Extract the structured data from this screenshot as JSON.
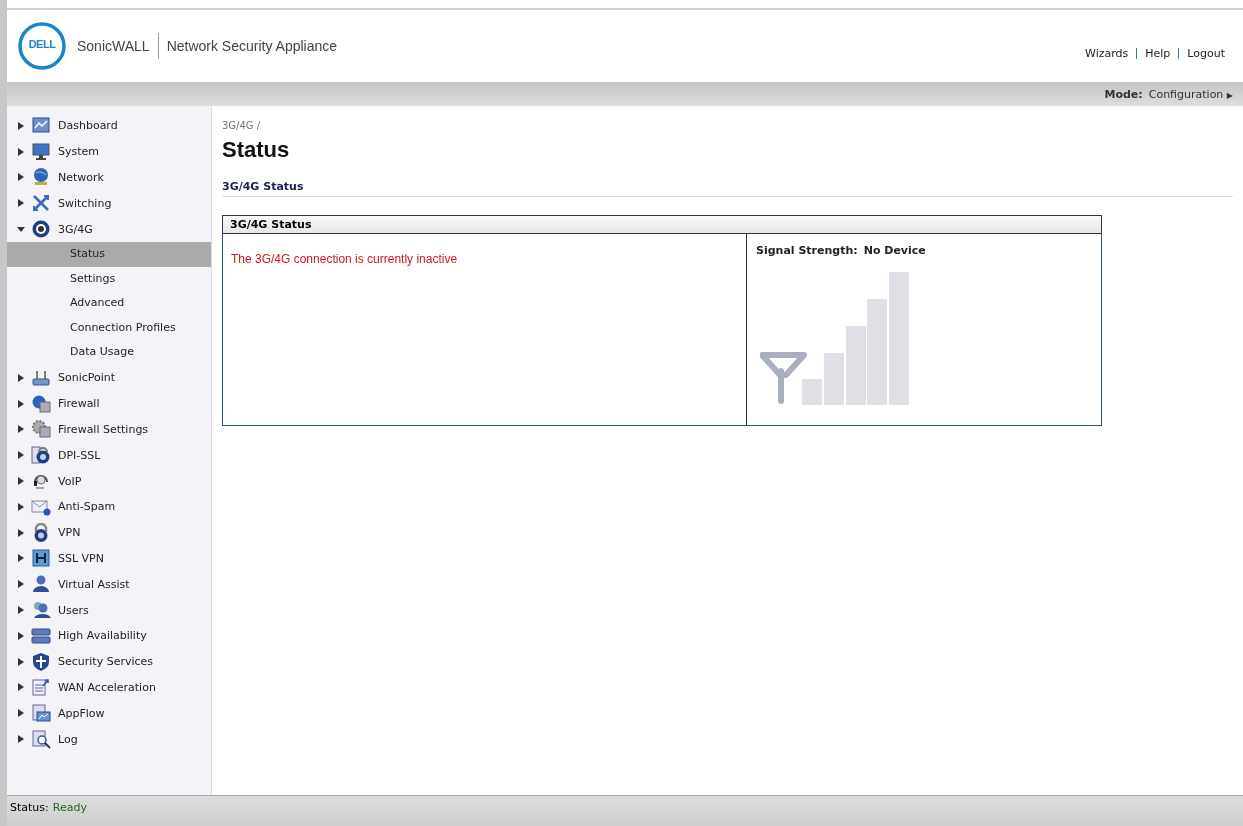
{
  "header": {
    "brand": "DELL",
    "product": "SonicWALL",
    "title": "Network Security Appliance",
    "links": [
      "Wizards",
      "Help",
      "Logout"
    ]
  },
  "toolbar": {
    "mode_label": "Mode:",
    "mode_value": "Configuration",
    "mode_arrow": "▶"
  },
  "sidebar": {
    "items": [
      {
        "label": "Dashboard",
        "expanded": false
      },
      {
        "label": "System",
        "expanded": false
      },
      {
        "label": "Network",
        "expanded": false
      },
      {
        "label": "Switching",
        "expanded": false
      },
      {
        "label": "3G/4G",
        "expanded": true,
        "children": [
          {
            "label": "Status",
            "selected": true
          },
          {
            "label": "Settings",
            "selected": false
          },
          {
            "label": "Advanced",
            "selected": false
          },
          {
            "label": "Connection Profiles",
            "selected": false
          },
          {
            "label": "Data Usage",
            "selected": false
          }
        ]
      },
      {
        "label": "SonicPoint",
        "expanded": false
      },
      {
        "label": "Firewall",
        "expanded": false
      },
      {
        "label": "Firewall Settings",
        "expanded": false
      },
      {
        "label": "DPI-SSL",
        "expanded": false
      },
      {
        "label": "VoIP",
        "expanded": false
      },
      {
        "label": "Anti-Spam",
        "expanded": false
      },
      {
        "label": "VPN",
        "expanded": false
      },
      {
        "label": "SSL VPN",
        "expanded": false
      },
      {
        "label": "Virtual Assist",
        "expanded": false
      },
      {
        "label": "Users",
        "expanded": false
      },
      {
        "label": "High Availability",
        "expanded": false
      },
      {
        "label": "Security Services",
        "expanded": false
      },
      {
        "label": "WAN Acceleration",
        "expanded": false
      },
      {
        "label": "AppFlow",
        "expanded": false
      },
      {
        "label": "Log",
        "expanded": false
      }
    ]
  },
  "content": {
    "breadcrumb": "3G/4G /",
    "title": "Status",
    "section_title": "3G/4G Status",
    "panel": {
      "title": "3G/4G Status",
      "message": "The 3G/4G connection is currently inactive",
      "signal_label": "Signal Strength:",
      "signal_value": "No Device"
    }
  },
  "status_bar": {
    "label": "Status:",
    "value": "Ready"
  }
}
